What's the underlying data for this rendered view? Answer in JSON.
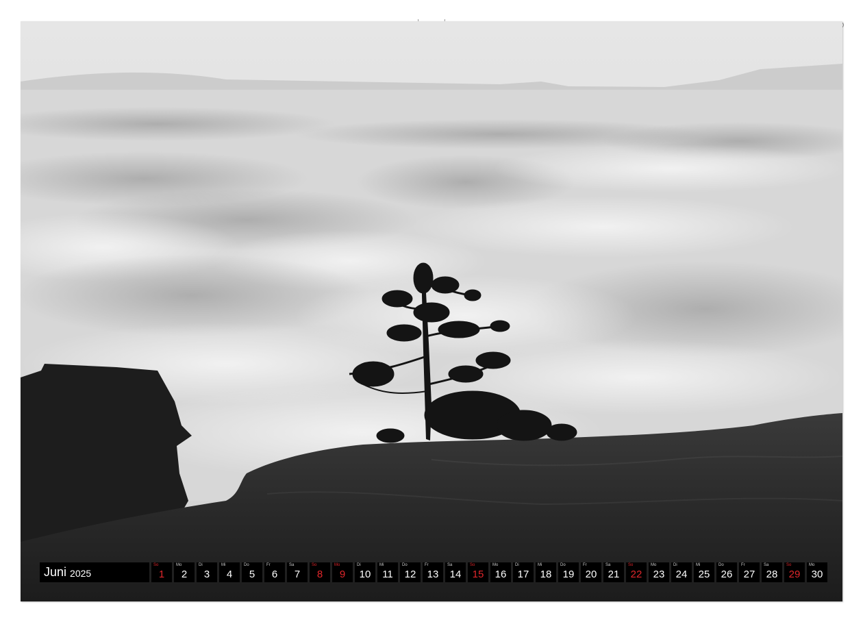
{
  "calendar": {
    "month": "Juni",
    "year": "2025",
    "days": [
      {
        "wd": "So",
        "n": "1",
        "red": true
      },
      {
        "wd": "Mo",
        "n": "2",
        "red": false
      },
      {
        "wd": "Di",
        "n": "3",
        "red": false
      },
      {
        "wd": "Mi",
        "n": "4",
        "red": false
      },
      {
        "wd": "Do",
        "n": "5",
        "red": false
      },
      {
        "wd": "Fr",
        "n": "6",
        "red": false
      },
      {
        "wd": "Sa",
        "n": "7",
        "red": false
      },
      {
        "wd": "So",
        "n": "8",
        "red": true
      },
      {
        "wd": "Mo",
        "n": "9",
        "red": true
      },
      {
        "wd": "Di",
        "n": "10",
        "red": false
      },
      {
        "wd": "Mi",
        "n": "11",
        "red": false
      },
      {
        "wd": "Do",
        "n": "12",
        "red": false
      },
      {
        "wd": "Fr",
        "n": "13",
        "red": false
      },
      {
        "wd": "Sa",
        "n": "14",
        "red": false
      },
      {
        "wd": "So",
        "n": "15",
        "red": true
      },
      {
        "wd": "Mo",
        "n": "16",
        "red": false
      },
      {
        "wd": "Di",
        "n": "17",
        "red": false
      },
      {
        "wd": "Mi",
        "n": "18",
        "red": false
      },
      {
        "wd": "Do",
        "n": "19",
        "red": false
      },
      {
        "wd": "Fr",
        "n": "20",
        "red": false
      },
      {
        "wd": "Sa",
        "n": "21",
        "red": false
      },
      {
        "wd": "So",
        "n": "22",
        "red": true
      },
      {
        "wd": "Mo",
        "n": "23",
        "red": false
      },
      {
        "wd": "Di",
        "n": "24",
        "red": false
      },
      {
        "wd": "Mi",
        "n": "25",
        "red": false
      },
      {
        "wd": "Do",
        "n": "26",
        "red": false
      },
      {
        "wd": "Fr",
        "n": "27",
        "red": false
      },
      {
        "wd": "Sa",
        "n": "28",
        "red": false
      },
      {
        "wd": "So",
        "n": "29",
        "red": true
      },
      {
        "wd": "Mo",
        "n": "30",
        "red": false
      }
    ]
  },
  "colors": {
    "strip_background": "#000000",
    "day_text": "#ffffff",
    "holiday_text": "#e0262b"
  },
  "photo": {
    "style": "black-and-white",
    "subject_icons": [
      "pine-tree-silhouette",
      "rock-outcrop",
      "sea-of-fog"
    ]
  }
}
